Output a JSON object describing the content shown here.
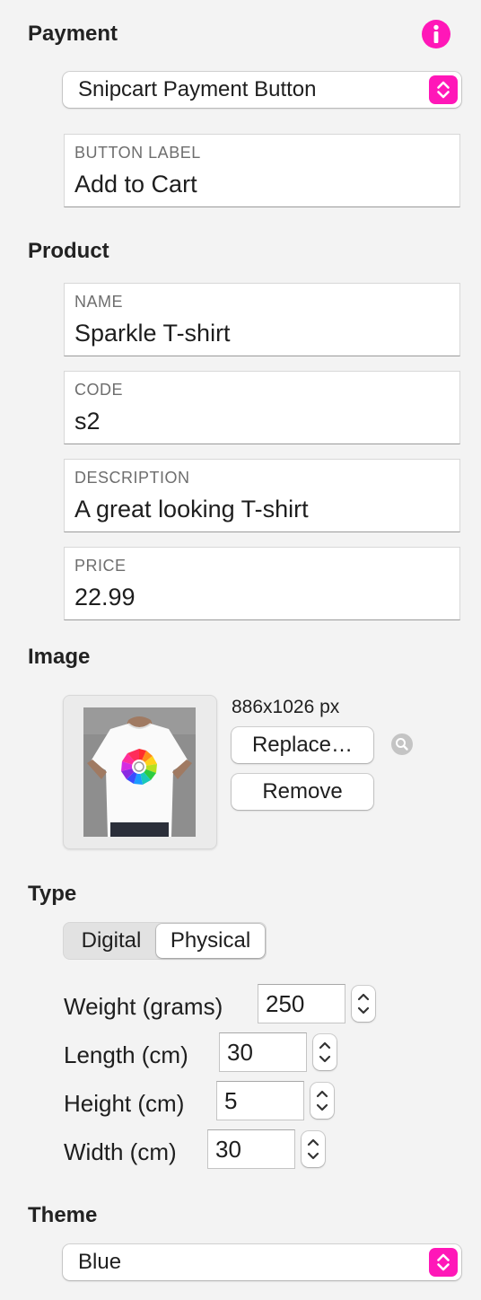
{
  "colors": {
    "accent": "#ff17b8",
    "background": "#f3f3f3"
  },
  "payment": {
    "title": "Payment",
    "info_icon": "info-icon",
    "selected_option": "Snipcart Payment Button",
    "button_label": {
      "label": "BUTTON LABEL",
      "value": "Add to Cart"
    }
  },
  "product": {
    "title": "Product",
    "fields": [
      {
        "label": "NAME",
        "value": "Sparkle T-shirt"
      },
      {
        "label": "CODE",
        "value": "s2"
      },
      {
        "label": "DESCRIPTION",
        "value": "A great looking T-shirt"
      },
      {
        "label": "PRICE",
        "value": "22.99"
      }
    ]
  },
  "image": {
    "title": "Image",
    "dimensions": "886x1026 px",
    "replace_label": "Replace…",
    "remove_label": "Remove",
    "zoom_icon": "magnifier-icon"
  },
  "type": {
    "title": "Type",
    "options": [
      "Digital",
      "Physical"
    ],
    "selected": "Physical",
    "weight": {
      "label": "Weight (grams)",
      "value": "250"
    },
    "length": {
      "label": "Length (cm)",
      "value": "30"
    },
    "height": {
      "label": "Height (cm)",
      "value": "5"
    },
    "width": {
      "label": "Width (cm)",
      "value": "30"
    }
  },
  "theme": {
    "title": "Theme",
    "selected_option": "Blue"
  }
}
